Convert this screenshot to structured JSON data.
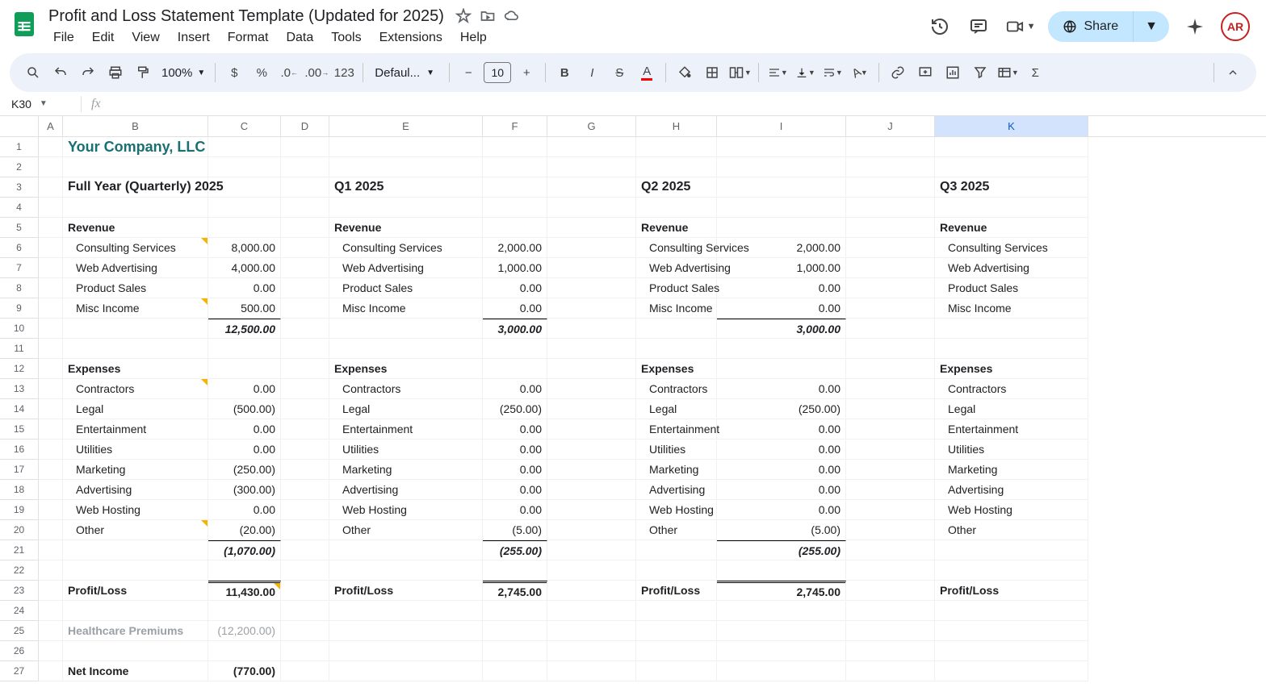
{
  "header": {
    "doc_title": "Profit and Loss Statement Template (Updated for 2025)",
    "menus": [
      "File",
      "Edit",
      "View",
      "Insert",
      "Format",
      "Data",
      "Tools",
      "Extensions",
      "Help"
    ],
    "share_label": "Share",
    "avatar_text": "AR"
  },
  "toolbar": {
    "zoom": "100%",
    "font_name": "Defaul...",
    "font_size": "10"
  },
  "name_box": "K30",
  "columns": [
    "A",
    "B",
    "C",
    "D",
    "E",
    "F",
    "G",
    "H",
    "I",
    "J",
    "K"
  ],
  "row_count": 27,
  "sheet": {
    "company": "Your Company, LLC",
    "full_year": {
      "title": "Full Year (Quarterly) 2025",
      "revenue_head": "Revenue",
      "rev": [
        {
          "label": "Consulting Services",
          "val": "8,000.00",
          "note": true
        },
        {
          "label": "Web Advertising",
          "val": "4,000.00"
        },
        {
          "label": "Product Sales",
          "val": "0.00"
        },
        {
          "label": "Misc Income",
          "val": "500.00",
          "note": true
        }
      ],
      "rev_total": "12,500.00",
      "expenses_head": "Expenses",
      "exp": [
        {
          "label": "Contractors",
          "val": "0.00",
          "note": true
        },
        {
          "label": "Legal",
          "val": "(500.00)"
        },
        {
          "label": "Entertainment",
          "val": "0.00"
        },
        {
          "label": "Utilities",
          "val": "0.00"
        },
        {
          "label": "Marketing",
          "val": "(250.00)"
        },
        {
          "label": "Advertising",
          "val": "(300.00)"
        },
        {
          "label": "Web Hosting",
          "val": "0.00"
        },
        {
          "label": "Other",
          "val": "(20.00)",
          "note": true
        }
      ],
      "exp_total": "(1,070.00)",
      "pl_label": "Profit/Loss",
      "pl_val": "11,430.00",
      "hc_label": "Healthcare Premiums",
      "hc_val": "(12,200.00)",
      "ni_label": "Net Income",
      "ni_val": "(770.00)"
    },
    "q1": {
      "title": "Q1 2025",
      "revenue_head": "Revenue",
      "rev": [
        {
          "label": "Consulting Services",
          "val": "2,000.00"
        },
        {
          "label": "Web Advertising",
          "val": "1,000.00"
        },
        {
          "label": "Product Sales",
          "val": "0.00"
        },
        {
          "label": "Misc Income",
          "val": "0.00"
        }
      ],
      "rev_total": "3,000.00",
      "expenses_head": "Expenses",
      "exp": [
        {
          "label": "Contractors",
          "val": "0.00"
        },
        {
          "label": "Legal",
          "val": "(250.00)"
        },
        {
          "label": "Entertainment",
          "val": "0.00"
        },
        {
          "label": "Utilities",
          "val": "0.00"
        },
        {
          "label": "Marketing",
          "val": "0.00"
        },
        {
          "label": "Advertising",
          "val": "0.00"
        },
        {
          "label": "Web Hosting",
          "val": "0.00"
        },
        {
          "label": "Other",
          "val": "(5.00)"
        }
      ],
      "exp_total": "(255.00)",
      "pl_label": "Profit/Loss",
      "pl_val": "2,745.00"
    },
    "q2": {
      "title": "Q2 2025",
      "revenue_head": "Revenue",
      "rev": [
        {
          "label": "Consulting Services",
          "val": "2,000.00"
        },
        {
          "label": "Web Advertising",
          "val": "1,000.00"
        },
        {
          "label": "Product Sales",
          "val": "0.00"
        },
        {
          "label": "Misc Income",
          "val": "0.00"
        }
      ],
      "rev_total": "3,000.00",
      "expenses_head": "Expenses",
      "exp": [
        {
          "label": "Contractors",
          "val": "0.00"
        },
        {
          "label": "Legal",
          "val": "(250.00)"
        },
        {
          "label": "Entertainment",
          "val": "0.00"
        },
        {
          "label": "Utilities",
          "val": "0.00"
        },
        {
          "label": "Marketing",
          "val": "0.00"
        },
        {
          "label": "Advertising",
          "val": "0.00"
        },
        {
          "label": "Web Hosting",
          "val": "0.00"
        },
        {
          "label": "Other",
          "val": "(5.00)"
        }
      ],
      "exp_total": "(255.00)",
      "pl_label": "Profit/Loss",
      "pl_val": "2,745.00"
    },
    "q3": {
      "title": "Q3 2025",
      "revenue_head": "Revenue",
      "rev_labels": [
        "Consulting Services",
        "Web Advertising",
        "Product Sales",
        "Misc Income"
      ],
      "expenses_head": "Expenses",
      "exp_labels": [
        "Contractors",
        "Legal",
        "Entertainment",
        "Utilities",
        "Marketing",
        "Advertising",
        "Web Hosting",
        "Other"
      ],
      "pl_label": "Profit/Loss"
    }
  }
}
